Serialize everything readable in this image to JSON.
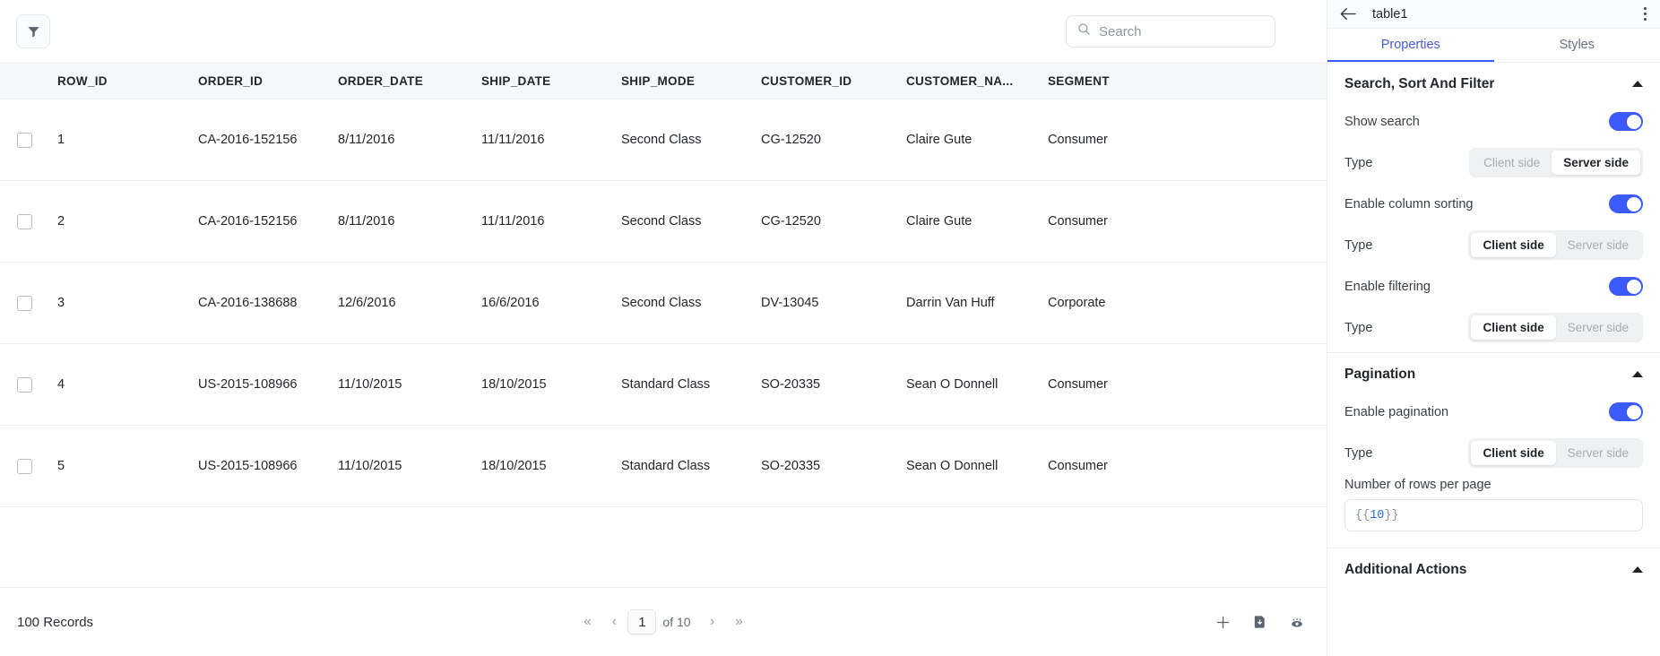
{
  "table_widget": {
    "toolbar": {
      "filter_icon": "filter-funnel-icon",
      "search": {
        "placeholder": "Search",
        "value": "",
        "icon": "search-icon"
      }
    },
    "columns": [
      "ROW_ID",
      "ORDER_ID",
      "ORDER_DATE",
      "SHIP_DATE",
      "SHIP_MODE",
      "CUSTOMER_ID",
      "CUSTOMER_NA...",
      "SEGMENT"
    ],
    "rows": [
      {
        "row_id": "1",
        "order_id": "CA-2016-152156",
        "order_date": "8/11/2016",
        "ship_date": "11/11/2016",
        "ship_mode": "Second Class",
        "customer_id": "CG-12520",
        "customer_name": "Claire Gute",
        "segment": "Consumer"
      },
      {
        "row_id": "2",
        "order_id": "CA-2016-152156",
        "order_date": "8/11/2016",
        "ship_date": "11/11/2016",
        "ship_mode": "Second Class",
        "customer_id": "CG-12520",
        "customer_name": "Claire Gute",
        "segment": "Consumer"
      },
      {
        "row_id": "3",
        "order_id": "CA-2016-138688",
        "order_date": "12/6/2016",
        "ship_date": "16/6/2016",
        "ship_mode": "Second Class",
        "customer_id": "DV-13045",
        "customer_name": "Darrin Van Huff",
        "segment": "Corporate"
      },
      {
        "row_id": "4",
        "order_id": "US-2015-108966",
        "order_date": "11/10/2015",
        "ship_date": "18/10/2015",
        "ship_mode": "Standard Class",
        "customer_id": "SO-20335",
        "customer_name": "Sean O Donnell",
        "segment": "Consumer"
      },
      {
        "row_id": "5",
        "order_id": "US-2015-108966",
        "order_date": "11/10/2015",
        "ship_date": "18/10/2015",
        "ship_mode": "Standard Class",
        "customer_id": "SO-20335",
        "customer_name": "Sean O Donnell",
        "segment": "Consumer"
      }
    ],
    "footer": {
      "records_label": "100 Records",
      "pagination": {
        "first_label": "«",
        "prev_label": "‹",
        "current_page": "1",
        "of_label": "of 10",
        "next_label": "›",
        "last_label": "»"
      },
      "actions": [
        "add-icon",
        "download-icon",
        "eye-icon"
      ]
    }
  },
  "panel": {
    "title": "table1",
    "back_icon": "back-arrow-icon",
    "menu_icon": "kebab-menu-icon",
    "tabs": [
      {
        "label": "Properties",
        "active": true
      },
      {
        "label": "Styles",
        "active": false
      }
    ],
    "sections": [
      {
        "title": "Search, Sort And Filter",
        "rows": [
          {
            "kind": "toggle",
            "label": "Show search",
            "on": true
          },
          {
            "kind": "segment",
            "label": "Type",
            "options": [
              "Client side",
              "Server side"
            ],
            "selected": "Server side"
          },
          {
            "kind": "toggle",
            "label": "Enable column sorting",
            "on": true
          },
          {
            "kind": "segment",
            "label": "Type",
            "options": [
              "Client side",
              "Server side"
            ],
            "selected": "Client side"
          },
          {
            "kind": "toggle",
            "label": "Enable filtering",
            "on": true
          },
          {
            "kind": "segment",
            "label": "Type",
            "options": [
              "Client side",
              "Server side"
            ],
            "selected": "Client side"
          }
        ]
      },
      {
        "title": "Pagination",
        "rows": [
          {
            "kind": "toggle",
            "label": "Enable pagination",
            "on": true
          },
          {
            "kind": "segment",
            "label": "Type",
            "options": [
              "Client side",
              "Server side"
            ],
            "selected": "Client side"
          },
          {
            "kind": "field",
            "label": "Number of rows per page",
            "open_brace": "{{",
            "value": "10",
            "close_brace": "}}"
          }
        ]
      },
      {
        "title": "Additional Actions",
        "rows": []
      }
    ]
  },
  "colors": {
    "accent": "#3b5bfd",
    "tab_active": "#4b5bd7",
    "header_bg": "#f7f8f9",
    "segment_bg": "#eef0f2",
    "code_value": "#2b6cd4"
  }
}
